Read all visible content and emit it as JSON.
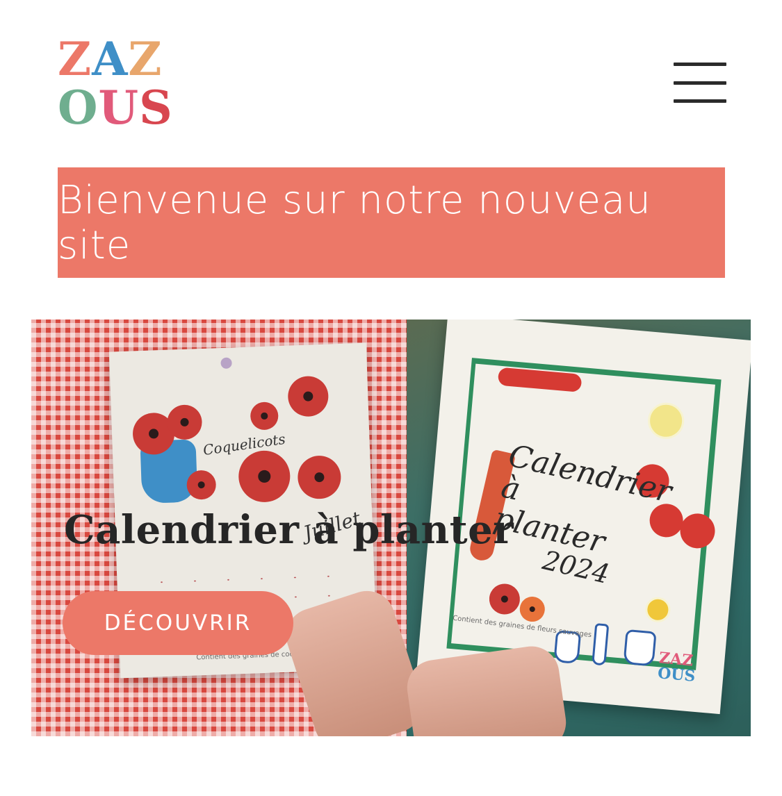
{
  "header": {
    "logo_row1": [
      "Z",
      "A",
      "Z"
    ],
    "logo_row2": [
      "O",
      "U",
      "S"
    ],
    "logo_colors_row1": [
      "#ec7868",
      "#3f8fc7",
      "#e8a66c"
    ],
    "logo_colors_row2": [
      "#6fae8f",
      "#e15a7a",
      "#d8464f"
    ],
    "menu_icon": "hamburger-menu-icon"
  },
  "banner": {
    "text": "Bienvenue sur notre nouveau site",
    "color": "#ec7868"
  },
  "hero": {
    "title": "Calendrier à planter",
    "cta_label": "DÉCOUVRIR",
    "left_card": {
      "label": "Coquelicots",
      "month": "Juillet",
      "footer": "Contient des graines de coquelicots"
    },
    "right_card": {
      "title_line1": "Calendrier",
      "title_line2": "à",
      "title_line3": "planter",
      "year": "2024",
      "brand_row1": "ZAZ",
      "brand_row2": "OUS",
      "footer": "Contient des graines de fleurs sauvages"
    }
  }
}
